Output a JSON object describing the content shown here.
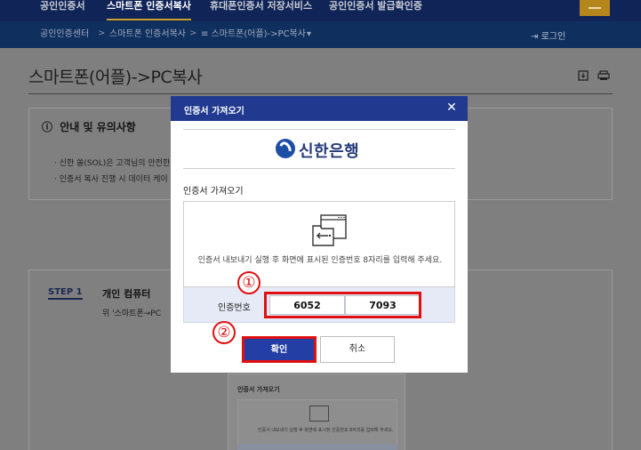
{
  "top_nav": {
    "tabs": [
      {
        "label": "공인인증서"
      },
      {
        "label": "스마트폰 인증서복사"
      },
      {
        "label": "휴대폰인증서 저장서비스"
      },
      {
        "label": "공인인증서 발급확인증"
      }
    ],
    "active_index": 1
  },
  "breadcrumb": {
    "items": [
      "공인인증센터",
      "스마트폰 인증서복사",
      "≡ 스마트폰(어플)->PC복사"
    ],
    "separator": ">",
    "dropdown_icon": "▾",
    "login_icon": "⇥",
    "login_label": "로그인"
  },
  "page": {
    "title": "스마트폰(어플)->PC복사",
    "icons": [
      "download-icon",
      "print-icon"
    ]
  },
  "notice": {
    "icon": "ⓘ",
    "heading": "안내 및 유의사항",
    "lines": [
      "· 신한 쏠(SOL)은 고객님의 안전한",
      "· 인증서 복사 진행 시 데이터 케이"
    ]
  },
  "step": {
    "label": "STEP 1",
    "title": "개인 컴퓨터",
    "desc": "위 '스마트폰→PC"
  },
  "thumbnail": {
    "title": "인증서 가져오기",
    "text": "인증서 내보내기 실행 후 화면에 표시된 인증번호 8자리를 입력해 주세요."
  },
  "modal": {
    "title": "인증서 가져오기",
    "close_icon": "✕",
    "bank_name": "신한은행",
    "section_label": "인증서 가져오기",
    "instruction": "인증서 내보내기 실행 후 화면에 표시된 인증번호 8자리를 입력해 주세요.",
    "cert_label": "인증번호",
    "field1_value": "6052",
    "field2_value": "7093",
    "confirm_label": "확인",
    "cancel_label": "취소"
  },
  "markers": [
    "①",
    "②"
  ],
  "colors": {
    "nav_bg": "#102457",
    "modal_header": "#213a8f",
    "confirm_button": "#233fa6",
    "highlight": "#e01010"
  }
}
